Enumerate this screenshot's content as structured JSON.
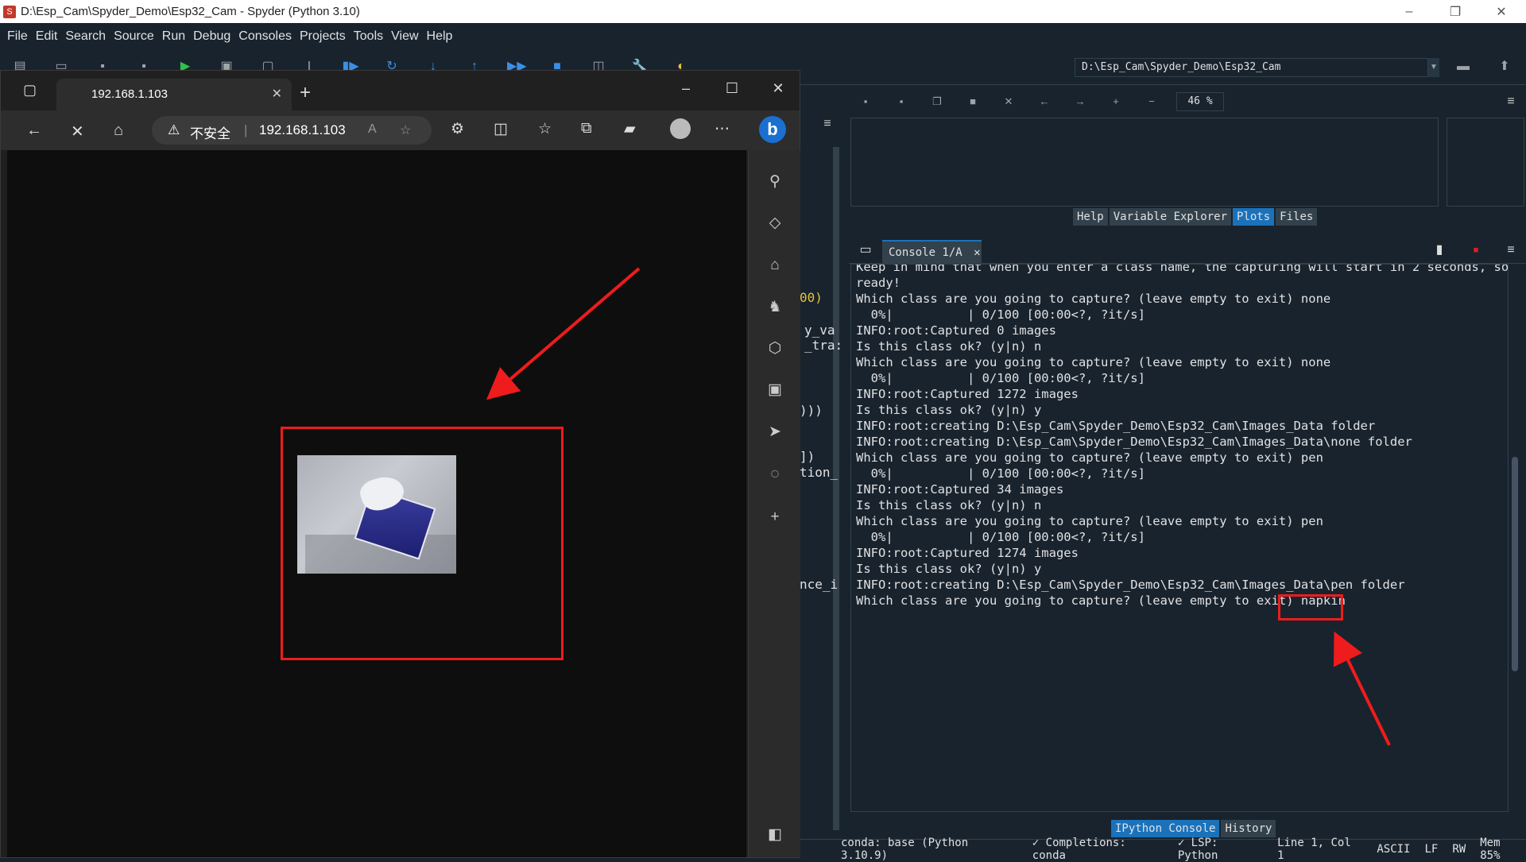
{
  "spyder": {
    "window_title": "D:\\Esp_Cam\\Spyder_Demo\\Esp32_Cam - Spyder (Python 3.10)",
    "app_icon": "spyder-icon",
    "menus": [
      "File",
      "Edit",
      "Search",
      "Source",
      "Run",
      "Debug",
      "Consoles",
      "Projects",
      "Tools",
      "View",
      "Help"
    ],
    "working_directory": "D:\\Esp_Cam\\Spyder_Demo\\Esp32_Cam",
    "editor_fragments": [
      "00)",
      "y_va",
      "_tra:",
      ")))",
      "])",
      "tion_",
      "nce_i"
    ],
    "plots": {
      "zoom": "46 %"
    },
    "upper_tabs": [
      "Help",
      "Variable Explorer",
      "Plots",
      "Files"
    ],
    "upper_active": "Plots",
    "console_tab": "Console 1/A",
    "console_lines": [
      "Keep in mind that when you enter a class name, the capturing will start in 2 seconds, so be",
      "ready!",
      "Which class are you going to capture? (leave empty to exit) none",
      "  0%|          | 0/100 [00:00<?, ?it/s]",
      "INFO:root:Captured 0 images",
      "Is this class ok? (y|n) n",
      "Which class are you going to capture? (leave empty to exit) none",
      "  0%|          | 0/100 [00:00<?, ?it/s]",
      "INFO:root:Captured 1272 images",
      "Is this class ok? (y|n) y",
      "INFO:root:creating D:\\Esp_Cam\\Spyder_Demo\\Esp32_Cam\\Images_Data folder",
      "INFO:root:creating D:\\Esp_Cam\\Spyder_Demo\\Esp32_Cam\\Images_Data\\none folder",
      "Which class are you going to capture? (leave empty to exit) pen",
      "  0%|          | 0/100 [00:00<?, ?it/s]",
      "INFO:root:Captured 34 images",
      "Is this class ok? (y|n) n",
      "Which class are you going to capture? (leave empty to exit) pen",
      "  0%|          | 0/100 [00:00<?, ?it/s]",
      "INFO:root:Captured 1274 images",
      "Is this class ok? (y|n) y",
      "INFO:root:creating D:\\Esp_Cam\\Spyder_Demo\\Esp32_Cam\\Images_Data\\pen folder",
      "Which class are you going to capture? (leave empty to exit) napkin"
    ],
    "lower_tabs": [
      "IPython Console",
      "History"
    ],
    "lower_active": "IPython Console",
    "status": [
      "conda: base (Python 3.10.9)",
      "✓ Completions: conda",
      "✓ LSP: Python",
      "Line 1, Col 1",
      "ASCII",
      "LF",
      "RW",
      "Mem 85%"
    ]
  },
  "browser": {
    "tab_title": "192.168.1.103",
    "address_warning": "不安全",
    "address_url": "192.168.1.103",
    "sidebar_icons": [
      "search-icon",
      "tag-icon",
      "toolbox-icon",
      "chess-icon",
      "office-icon",
      "outlook-icon",
      "send-icon",
      "bell-icon",
      "add-icon"
    ]
  },
  "colors": {
    "spyder_bg": "#19232d",
    "accent": "#1a72bb",
    "annotation": "#ee1c1c"
  }
}
